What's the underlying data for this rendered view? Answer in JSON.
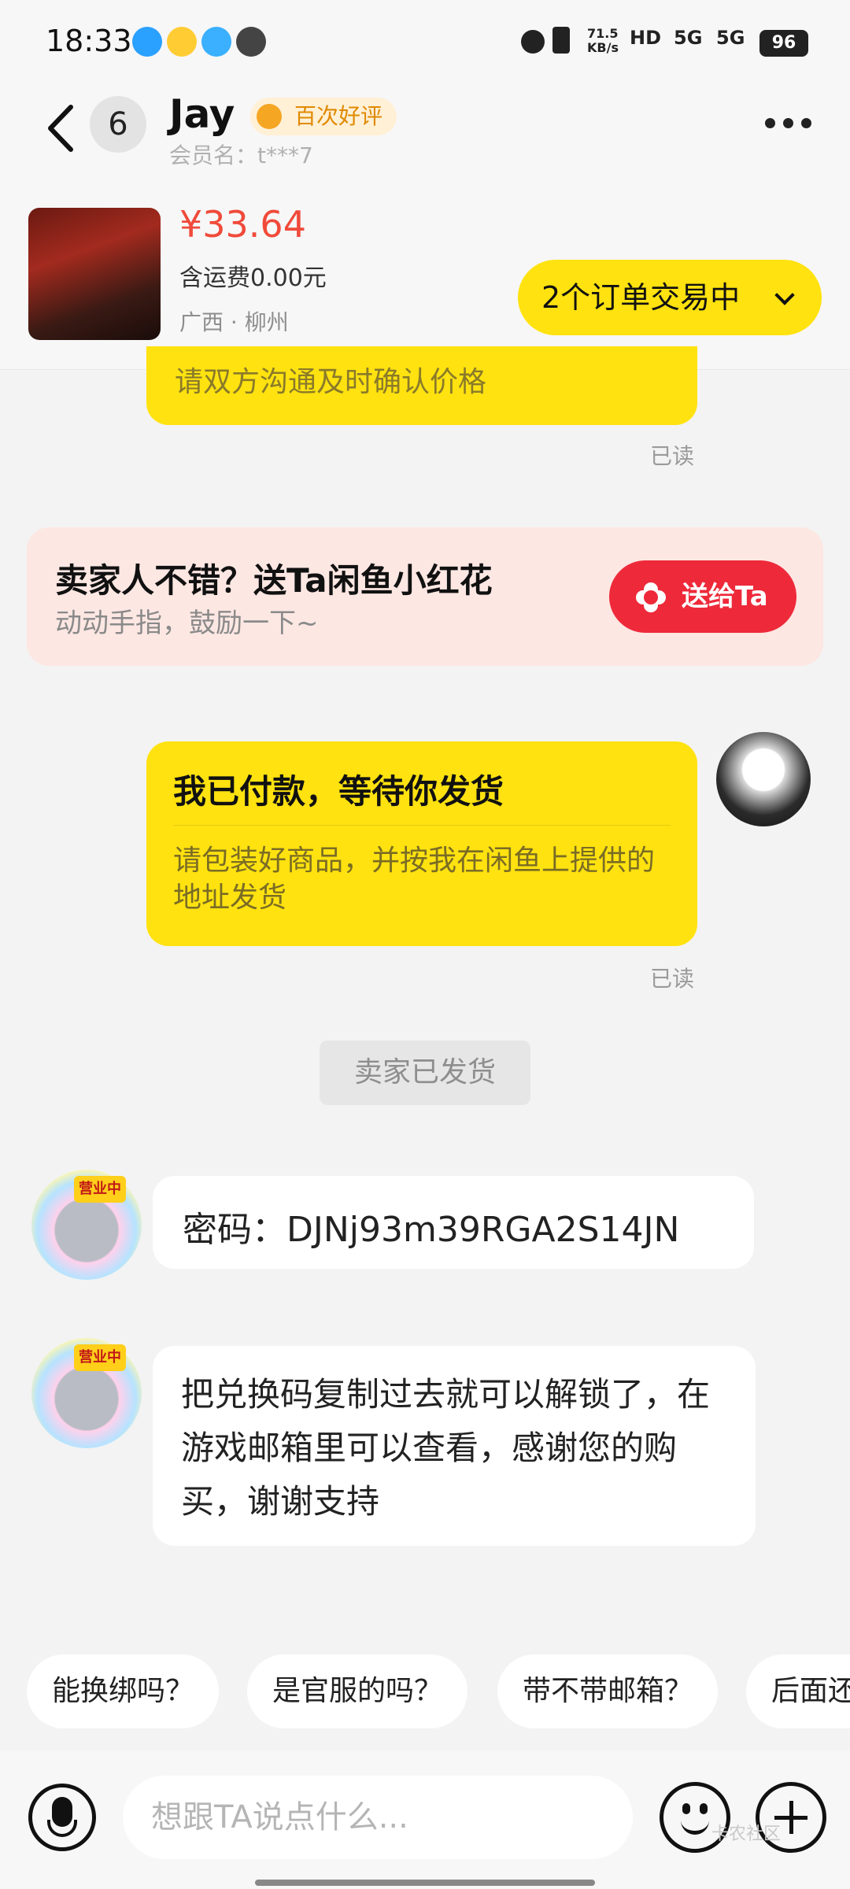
{
  "status_bar": {
    "time": "18:33",
    "net_speed": "71.5\nKB/s",
    "hd": "HD",
    "signal1": "5G",
    "signal2": "5G",
    "battery": "96"
  },
  "header": {
    "unread_count": "6",
    "name": "Jay",
    "badge": "百次好评",
    "member_label": "会员名：t***7"
  },
  "product": {
    "price": "¥33.64",
    "shipping": "含运费0.00元",
    "location": "广西 · 柳州",
    "orders_button": "2个订单交易中"
  },
  "chat": {
    "partial_message": "请双方沟通及时确认价格",
    "read_label": "已读",
    "promo": {
      "title": "卖家人不错？送Ta闲鱼小红花",
      "subtitle": "动动手指，鼓励一下~",
      "button": "送给Ta"
    },
    "paid_card": {
      "title": "我已付款，等待你发货",
      "body": "请包装好商品，并按我在闲鱼上提供的地址发货"
    },
    "system_notice": "卖家已发货",
    "seller_tag": "营业中",
    "password_message": "密码：DJNj93m39RGA2S14JN",
    "redeem_message": "把兑换码复制过去就可以解锁了，在游戏邮箱里可以查看，感谢您的购买，谢谢支持"
  },
  "quick_replies": [
    "能换绑吗？",
    "是官服的吗？",
    "带不带邮箱？",
    "后面还"
  ],
  "input": {
    "placeholder": "想跟TA说点什么..."
  },
  "watermark": "卡农社区",
  "colors": {
    "accent_yellow": "#ffe20f",
    "price_red": "#f04a3a",
    "gift_red": "#ee2a3a"
  }
}
